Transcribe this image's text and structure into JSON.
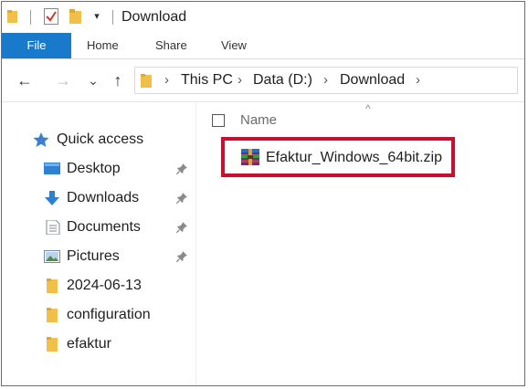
{
  "window": {
    "title": "Download"
  },
  "quick_access_toolbar": {
    "dropdown_glyph": "▾"
  },
  "ribbon": {
    "tabs": [
      {
        "label": "File",
        "active": true
      },
      {
        "label": "Home"
      },
      {
        "label": "Share"
      },
      {
        "label": "View"
      }
    ]
  },
  "navigation": {
    "back_glyph": "←",
    "forward_glyph": "→",
    "recent_glyph": "⌄",
    "up_glyph": "↑",
    "chevron_glyph": "›",
    "breadcrumbs": [
      "This PC",
      "Data (D:)",
      "Download"
    ]
  },
  "sidebar": {
    "header": {
      "label": "Quick access",
      "icon": "star-icon"
    },
    "items": [
      {
        "label": "Desktop",
        "icon": "desktop-icon",
        "pinned": true
      },
      {
        "label": "Downloads",
        "icon": "downloads-icon",
        "pinned": true
      },
      {
        "label": "Documents",
        "icon": "documents-icon",
        "pinned": true
      },
      {
        "label": "Pictures",
        "icon": "pictures-icon",
        "pinned": true
      },
      {
        "label": "2024-06-13",
        "icon": "folder-icon",
        "pinned": false
      },
      {
        "label": "configuration",
        "icon": "folder-icon",
        "pinned": false
      },
      {
        "label": "efaktur",
        "icon": "folder-icon",
        "pinned": false
      }
    ]
  },
  "content": {
    "columns": [
      "Name"
    ],
    "sort_glyph": "^",
    "files": [
      {
        "name": "Efaktur_Windows_64bit.zip",
        "icon": "zip-archive-icon",
        "highlighted": true
      }
    ]
  },
  "colors": {
    "file_tab": "#1979ca",
    "highlight_border": "#c8102e",
    "folder_yellow": "#f0c04a"
  }
}
